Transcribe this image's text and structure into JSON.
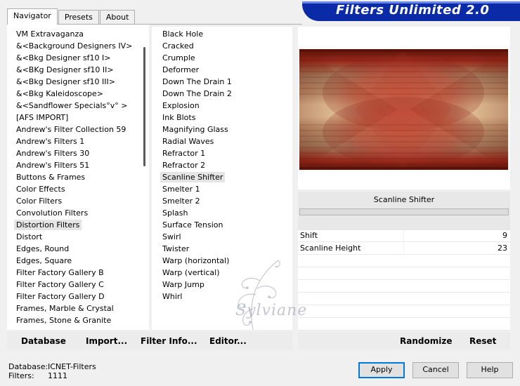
{
  "tabs": [
    {
      "label": "Navigator",
      "active": true
    },
    {
      "label": "Presets",
      "active": false
    },
    {
      "label": "About",
      "active": false
    }
  ],
  "banner": {
    "title": "Filters Unlimited 2.0",
    "color": "#0b2aa8"
  },
  "categories": {
    "selected": "Distortion Filters",
    "items": [
      "VM Extravaganza",
      "&<Background Designers IV>",
      "&<Bkg Designer sf10 I>",
      "&<BKg Designer sf10 II>",
      "&<Bkg Designer sf10 III>",
      "&<Bkg Kaleidoscope>",
      "&<Sandflower Specials°v° >",
      "[AFS IMPORT]",
      "Andrew's Filter Collection 59",
      "Andrew's Filters 1",
      "Andrew's Filters 30",
      "Andrew's Filters 51",
      "Buttons & Frames",
      "Color Effects",
      "Color Filters",
      "Convolution Filters",
      "Distortion Filters",
      "Distort",
      "Edges, Round",
      "Edges, Square",
      "Filter Factory Gallery B",
      "Filter Factory Gallery C",
      "Filter Factory Gallery D",
      "Frames, Marble & Crystal",
      "Frames, Stone & Granite"
    ]
  },
  "filters": {
    "selected": "Scanline Shifter",
    "items": [
      "Black Hole",
      "Cracked",
      "Crumple",
      "Deformer",
      "Down The Drain 1",
      "Down The Drain 2",
      "Explosion",
      "Ink Blots",
      "Magnifying Glass",
      "Radial Waves",
      "Refractor 1",
      "Refractor 2",
      "Scanline Shifter",
      "Smelter 1",
      "Smelter 2",
      "Splash",
      "Surface Tension",
      "Swirl",
      "Twister",
      "Warp (horizontal)",
      "Warp (vertical)",
      "Warp Jump",
      "Whirl"
    ]
  },
  "preview": {
    "filter_name": "Scanline Shifter",
    "colors": {
      "dark_red": "#6b1a10",
      "red": "#b8392a",
      "tan": "#a88b6a",
      "cream": "#f3dfae"
    }
  },
  "params": [
    {
      "label": "Shift",
      "value": "9"
    },
    {
      "label": "Scanline Height",
      "value": "23"
    }
  ],
  "toolbar": {
    "database": "Database",
    "import": "Import...",
    "filter_info": "Filter Info...",
    "editor": "Editor...",
    "randomize": "Randomize",
    "reset": "Reset"
  },
  "status": {
    "database_key": "Database:",
    "database_value": "ICNET-Filters",
    "filters_key": "Filters:",
    "filters_value": "1111"
  },
  "buttons": {
    "apply": "Apply",
    "cancel": "Cancel",
    "help": "Help"
  },
  "watermark": {
    "text": "Sylviane"
  }
}
